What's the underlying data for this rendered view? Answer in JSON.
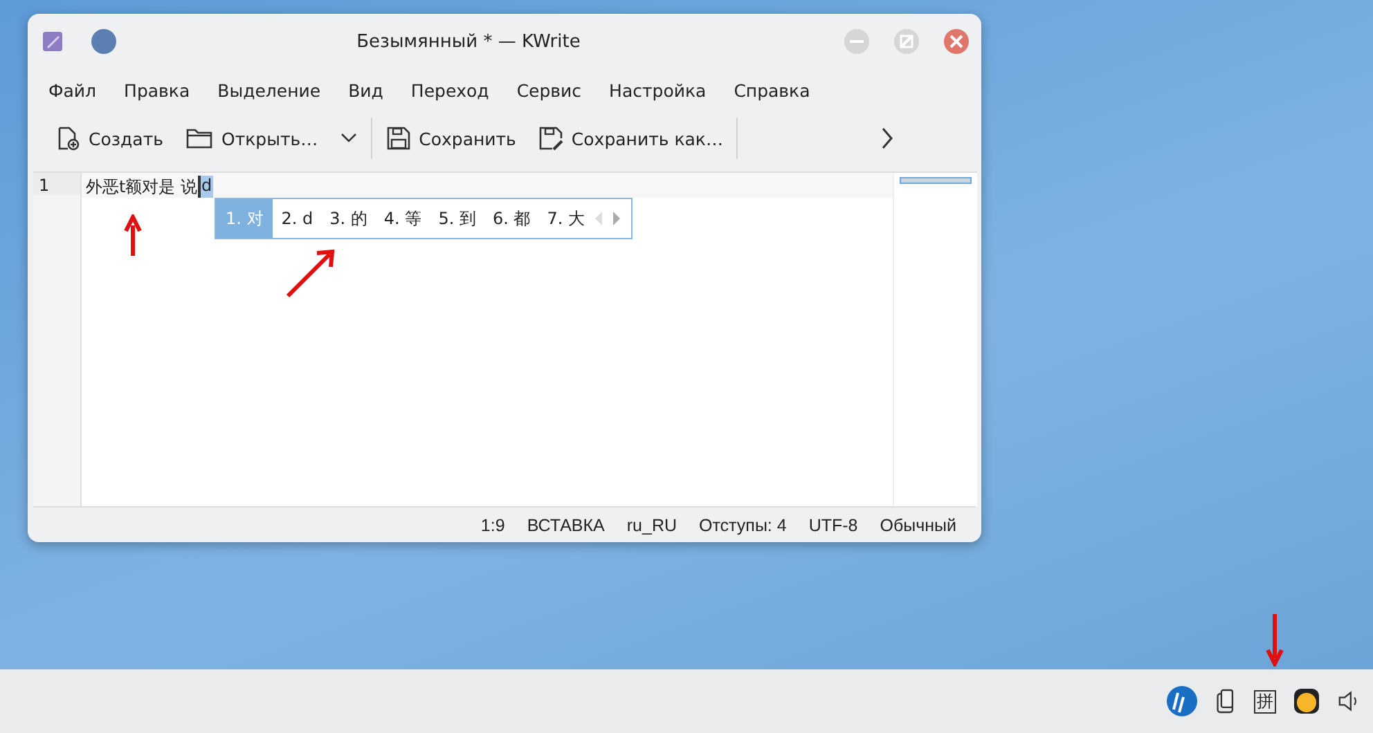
{
  "window": {
    "title": "Безымянный * — KWrite"
  },
  "menu": [
    "Файл",
    "Правка",
    "Выделение",
    "Вид",
    "Переход",
    "Сервис",
    "Настройка",
    "Справка"
  ],
  "toolbar": [
    {
      "kind": "new",
      "label": "Создать"
    },
    {
      "kind": "open",
      "label": "Открыть…"
    },
    {
      "kind": "save",
      "label": "Сохранить"
    },
    {
      "kind": "saveas",
      "label": "Сохранить как…"
    }
  ],
  "editor": {
    "line_number": "1",
    "text": "外恶t额对是 说",
    "preedit": "d"
  },
  "candidates": [
    {
      "label": "1. 对",
      "selected": true
    },
    {
      "label": "2. d",
      "selected": false
    },
    {
      "label": "3. 的",
      "selected": false
    },
    {
      "label": "4. 等",
      "selected": false
    },
    {
      "label": "5. 到",
      "selected": false
    },
    {
      "label": "6. 都",
      "selected": false
    },
    {
      "label": "7. 大",
      "selected": false
    }
  ],
  "status_bar": [
    "1:9",
    "ВСТАВКА",
    "ru_RU",
    "Отступы: 4",
    "UTF-8",
    "Обычный"
  ],
  "tray": {
    "input_method": "拼"
  }
}
